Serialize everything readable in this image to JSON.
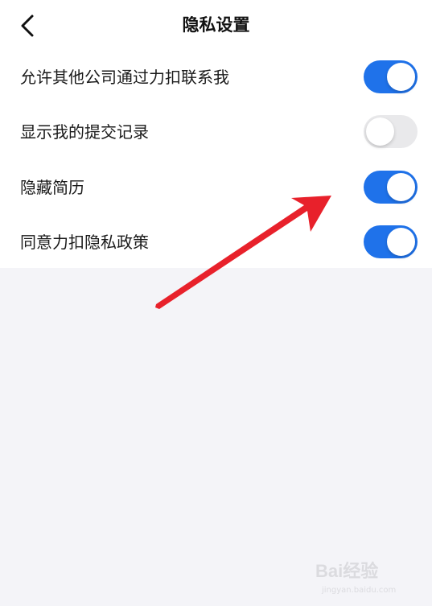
{
  "header": {
    "title": "隐私设置",
    "back_icon": "chevron-left-icon"
  },
  "settings": [
    {
      "label": "允许其他公司通过力扣联系我",
      "enabled": true
    },
    {
      "label": "显示我的提交记录",
      "enabled": false
    },
    {
      "label": "隐藏简历",
      "enabled": true
    },
    {
      "label": "同意力扣隐私政策",
      "enabled": true
    }
  ],
  "colors": {
    "toggle_on": "#1f72ea",
    "toggle_off": "#e9e9eb",
    "annotation_arrow": "#e8212b",
    "background": "#f4f4f8"
  },
  "watermark": {
    "logo_text": "Bai经验",
    "subtext": "jingyan.baidu.com"
  }
}
